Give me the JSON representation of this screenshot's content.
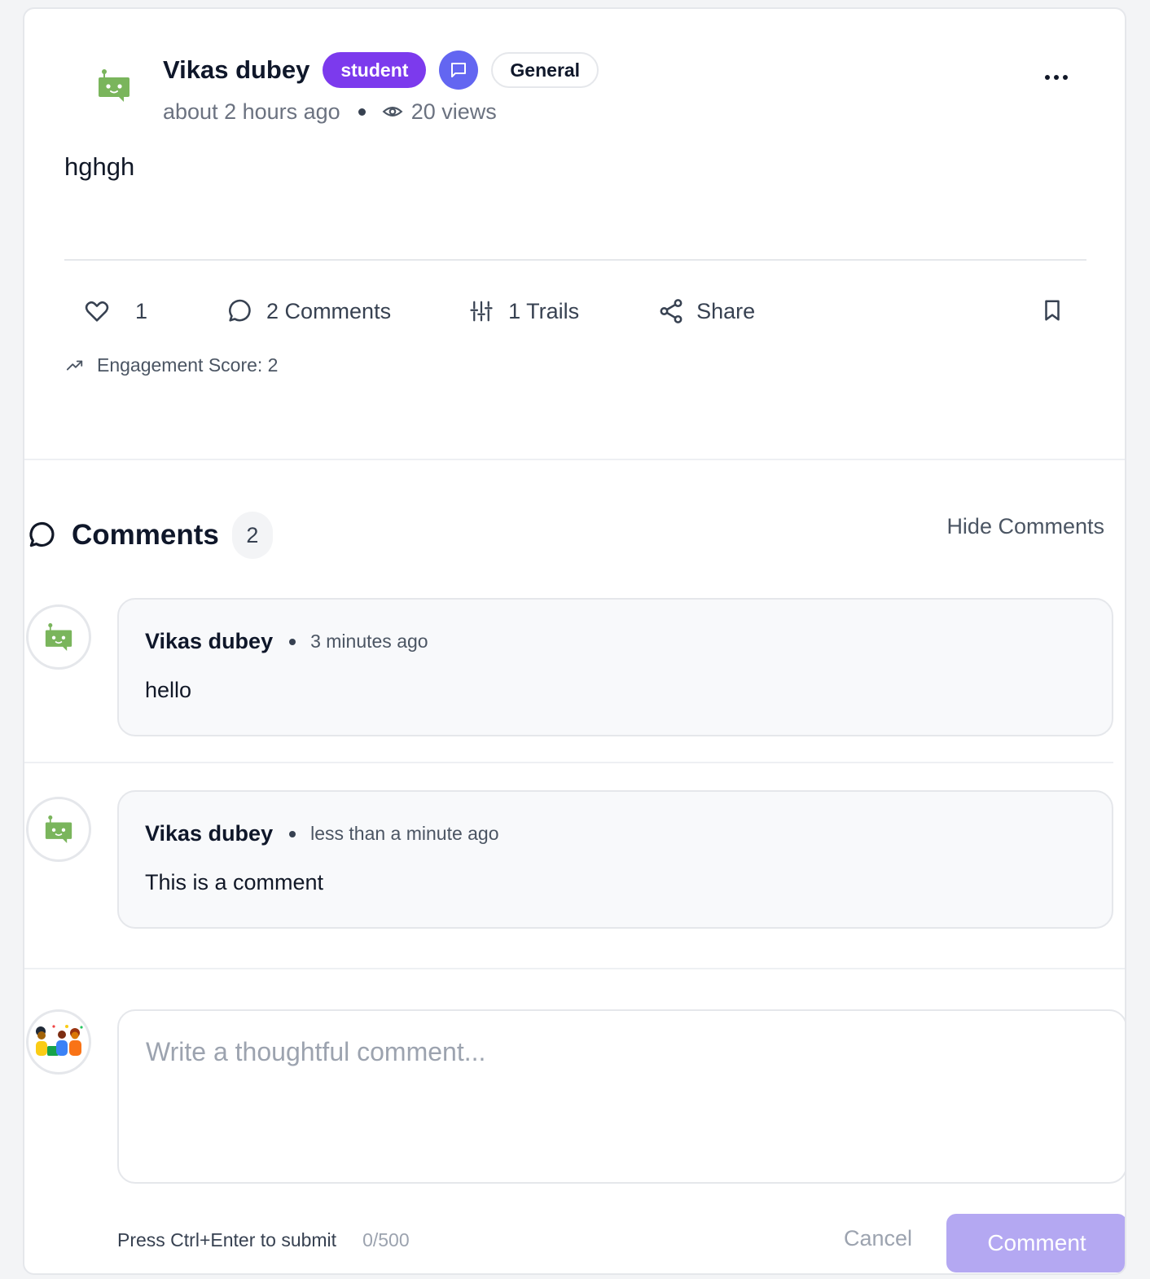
{
  "post": {
    "author": "Vikas dubey",
    "role_badge": "student",
    "category": "General",
    "time": "about 2 hours ago",
    "views": "20 views",
    "body": "hghgh",
    "actions": {
      "likes": "1",
      "comments": "2 Comments",
      "trails": "1 Trails",
      "share": "Share"
    },
    "engagement": "Engagement Score: 2"
  },
  "comments_section": {
    "title": "Comments",
    "count": "2",
    "hide_label": "Hide Comments",
    "items": [
      {
        "author": "Vikas dubey",
        "time": "3 minutes ago",
        "text": "hello"
      },
      {
        "author": "Vikas dubey",
        "time": "less than a minute ago",
        "text": "This is a comment"
      }
    ]
  },
  "composer": {
    "placeholder": "Write a thoughtful comment...",
    "value": "",
    "hint": "Press Ctrl+Enter to submit",
    "char_count": "0/500",
    "cancel_label": "Cancel",
    "submit_label": "Comment"
  },
  "colors": {
    "role_badge": "#7c3aed",
    "type_icon_bg": "#6366f1",
    "robot_avatar": "#7ab55c",
    "submit_button": "#b4a8f2"
  },
  "icons": [
    "robot-avatar-icon",
    "message-square-icon",
    "eye-icon",
    "more-horizontal-icon",
    "heart-icon",
    "message-circle-icon",
    "sliders-icon",
    "share-icon",
    "bookmark-icon",
    "trending-up-icon",
    "people-avatar-icon"
  ]
}
